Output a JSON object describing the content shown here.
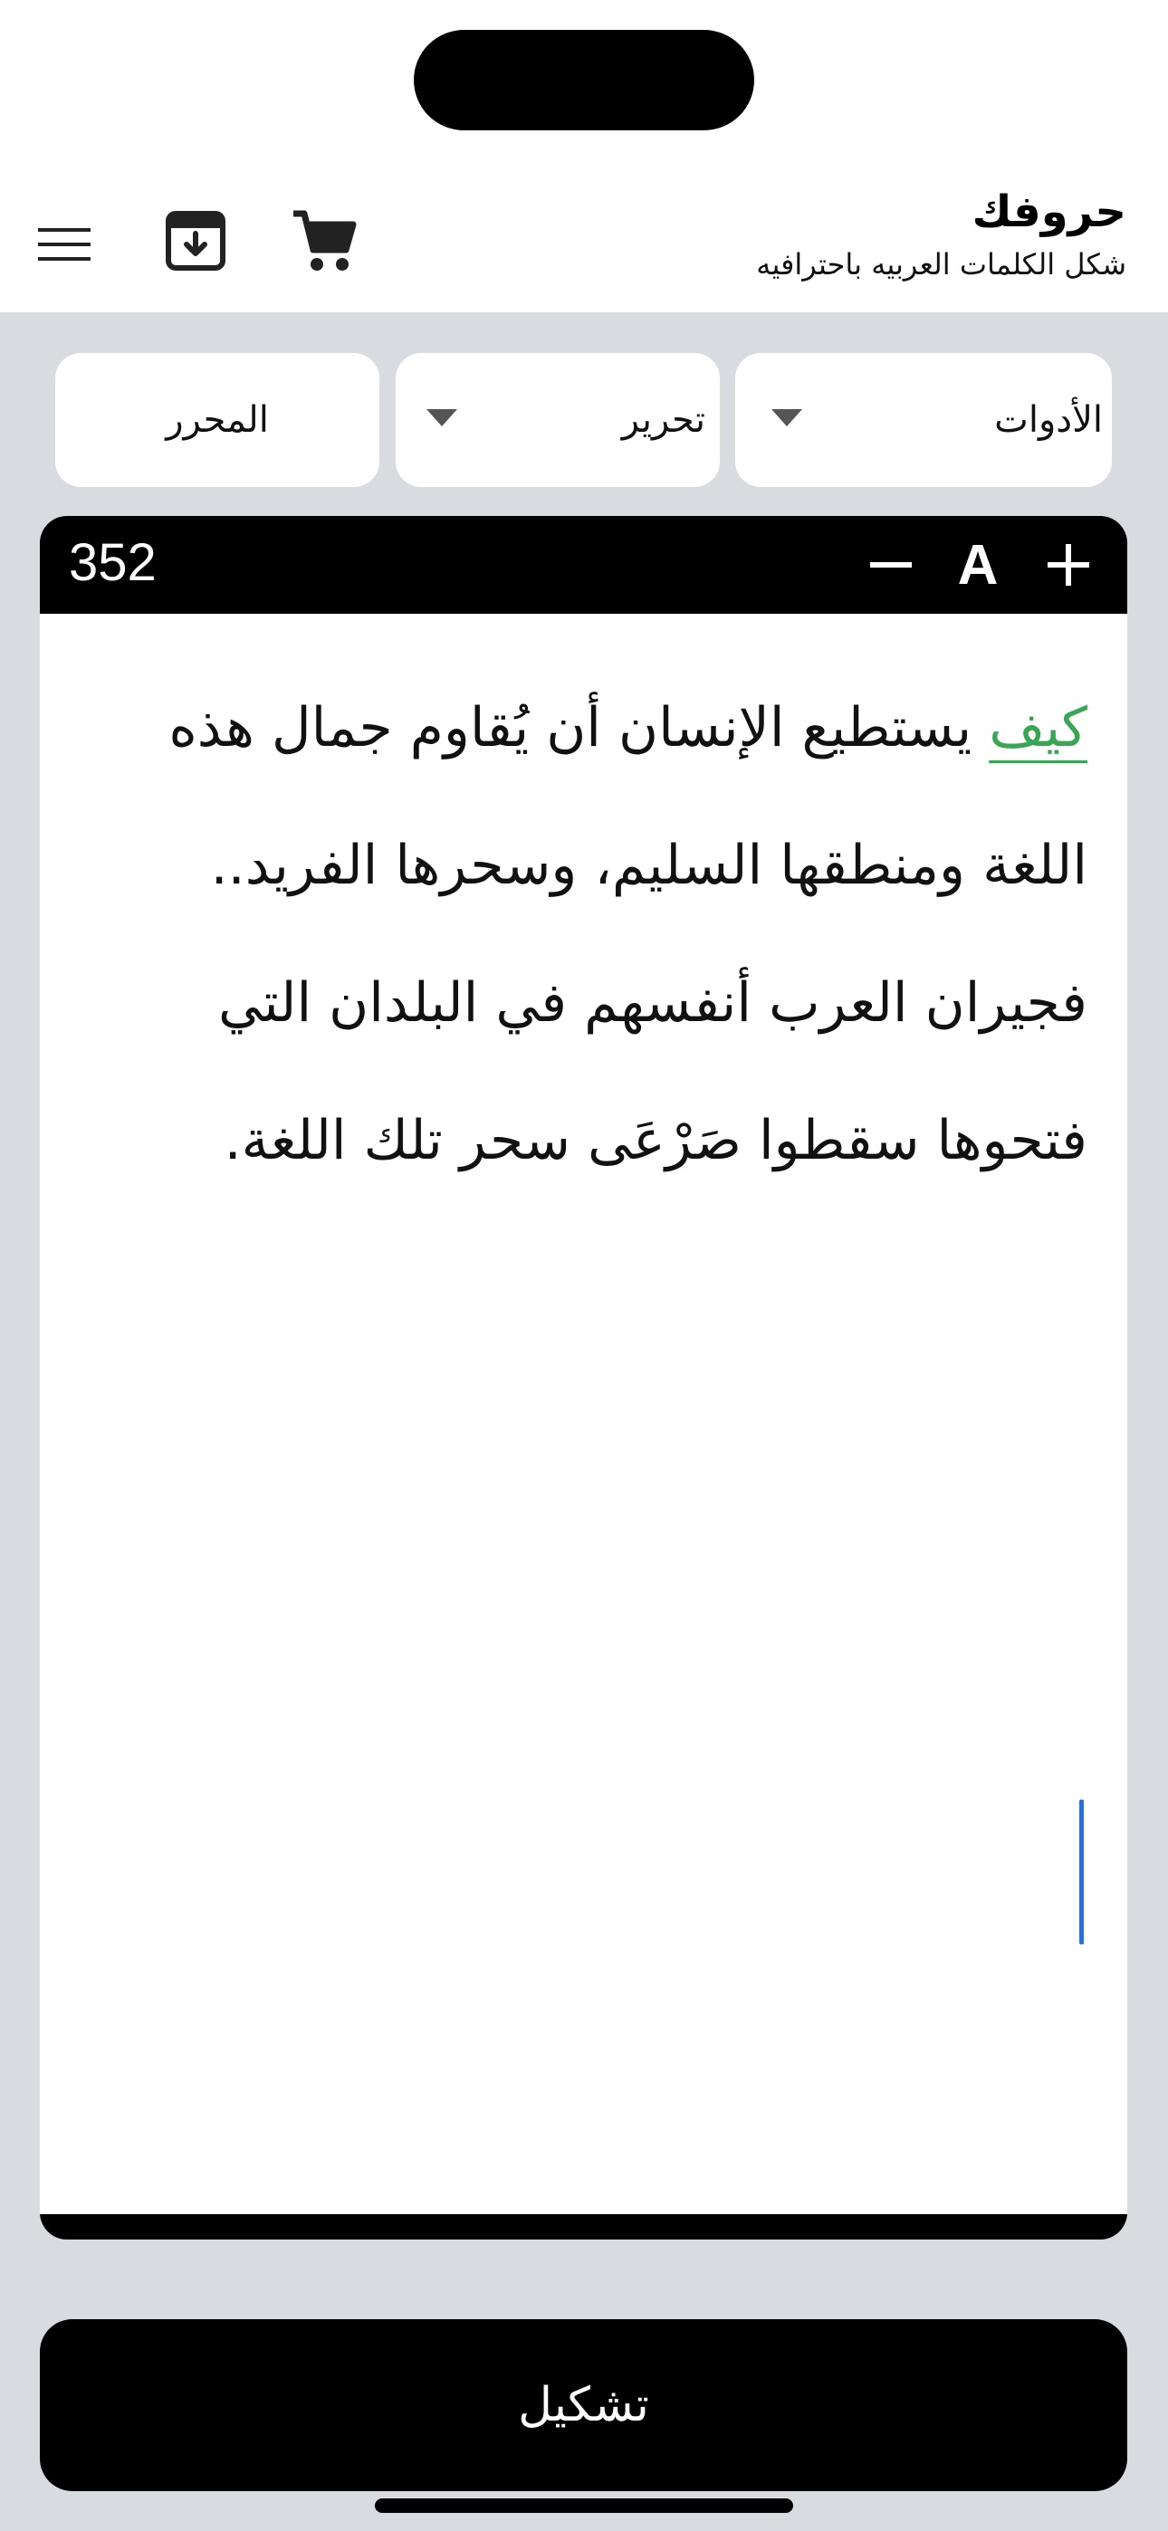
{
  "header": {
    "title": "حروفك",
    "subtitle": "شكل الكلمات العربيه باحترافيه"
  },
  "controls": {
    "tools_label": "الأدوات",
    "edit_label": "تحرير",
    "editor_label": "المحرر"
  },
  "editor": {
    "char_count": "352",
    "font_button": "A",
    "highlighted_word": "كيف",
    "text_rest": " يستطيع الإنسان أن يُقاوم جمال هذه اللغة ومنطقها السليم، وسحرها الفريد.. فجيران العرب أنفسهم في البلدان التي فتحوها سقطوا صَرْعَى سحر تلك اللغة.",
    "highlight_color": "#3aa655",
    "cursor_color": "#2f6fd0"
  },
  "actions": {
    "primary_label": "تشكيل"
  },
  "icons": {
    "menu": "hamburger-menu-icon",
    "archive": "archive-download-icon",
    "cart": "shopping-cart-icon",
    "dropdown": "caret-down-icon",
    "minus": "minus-icon",
    "plus": "plus-icon"
  }
}
